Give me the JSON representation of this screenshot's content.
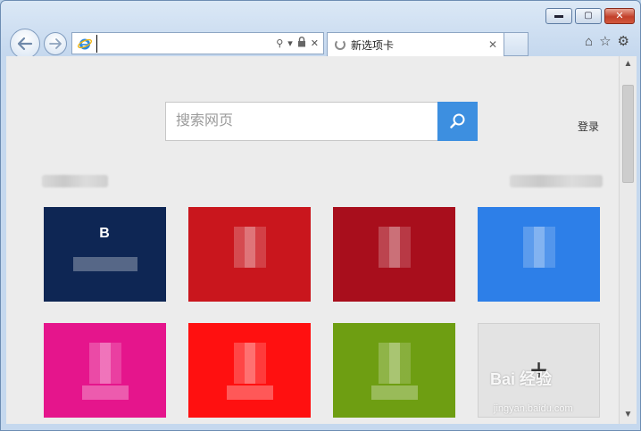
{
  "titlebar": {
    "minimize_glyph": "▬",
    "maximize_glyph": "▢",
    "close_glyph": "✕"
  },
  "address": {
    "value": "",
    "search_glyph": "⚲",
    "dropdown_glyph": "▾",
    "lock_glyph": "🔒",
    "stop_glyph": "✕"
  },
  "tab": {
    "title": "新选项卡",
    "close_glyph": "✕"
  },
  "toolbar": {
    "home_glyph": "⌂",
    "favorites_glyph": "☆",
    "tools_glyph": "⚙"
  },
  "search": {
    "placeholder": "搜索网页"
  },
  "login_label": "登录",
  "tiles": [
    {
      "color": "#0e2654",
      "label": ""
    },
    {
      "color": "#c9161d",
      "label": ""
    },
    {
      "color": "#a80e1c",
      "label": ""
    },
    {
      "color": "#2d7fe8",
      "label": ""
    },
    {
      "color": "#e5158c",
      "label": ""
    },
    {
      "color": "#ff1010",
      "label": ""
    },
    {
      "color": "#6e9e12",
      "label": ""
    }
  ],
  "tile_b_letter": "B",
  "add_tile_glyph": "+",
  "watermark": {
    "main": "Bai 经验",
    "sub": "jingyan.baidu.com"
  },
  "colors": {
    "search_button": "#3d8fe0",
    "content_bg": "#ececec"
  }
}
